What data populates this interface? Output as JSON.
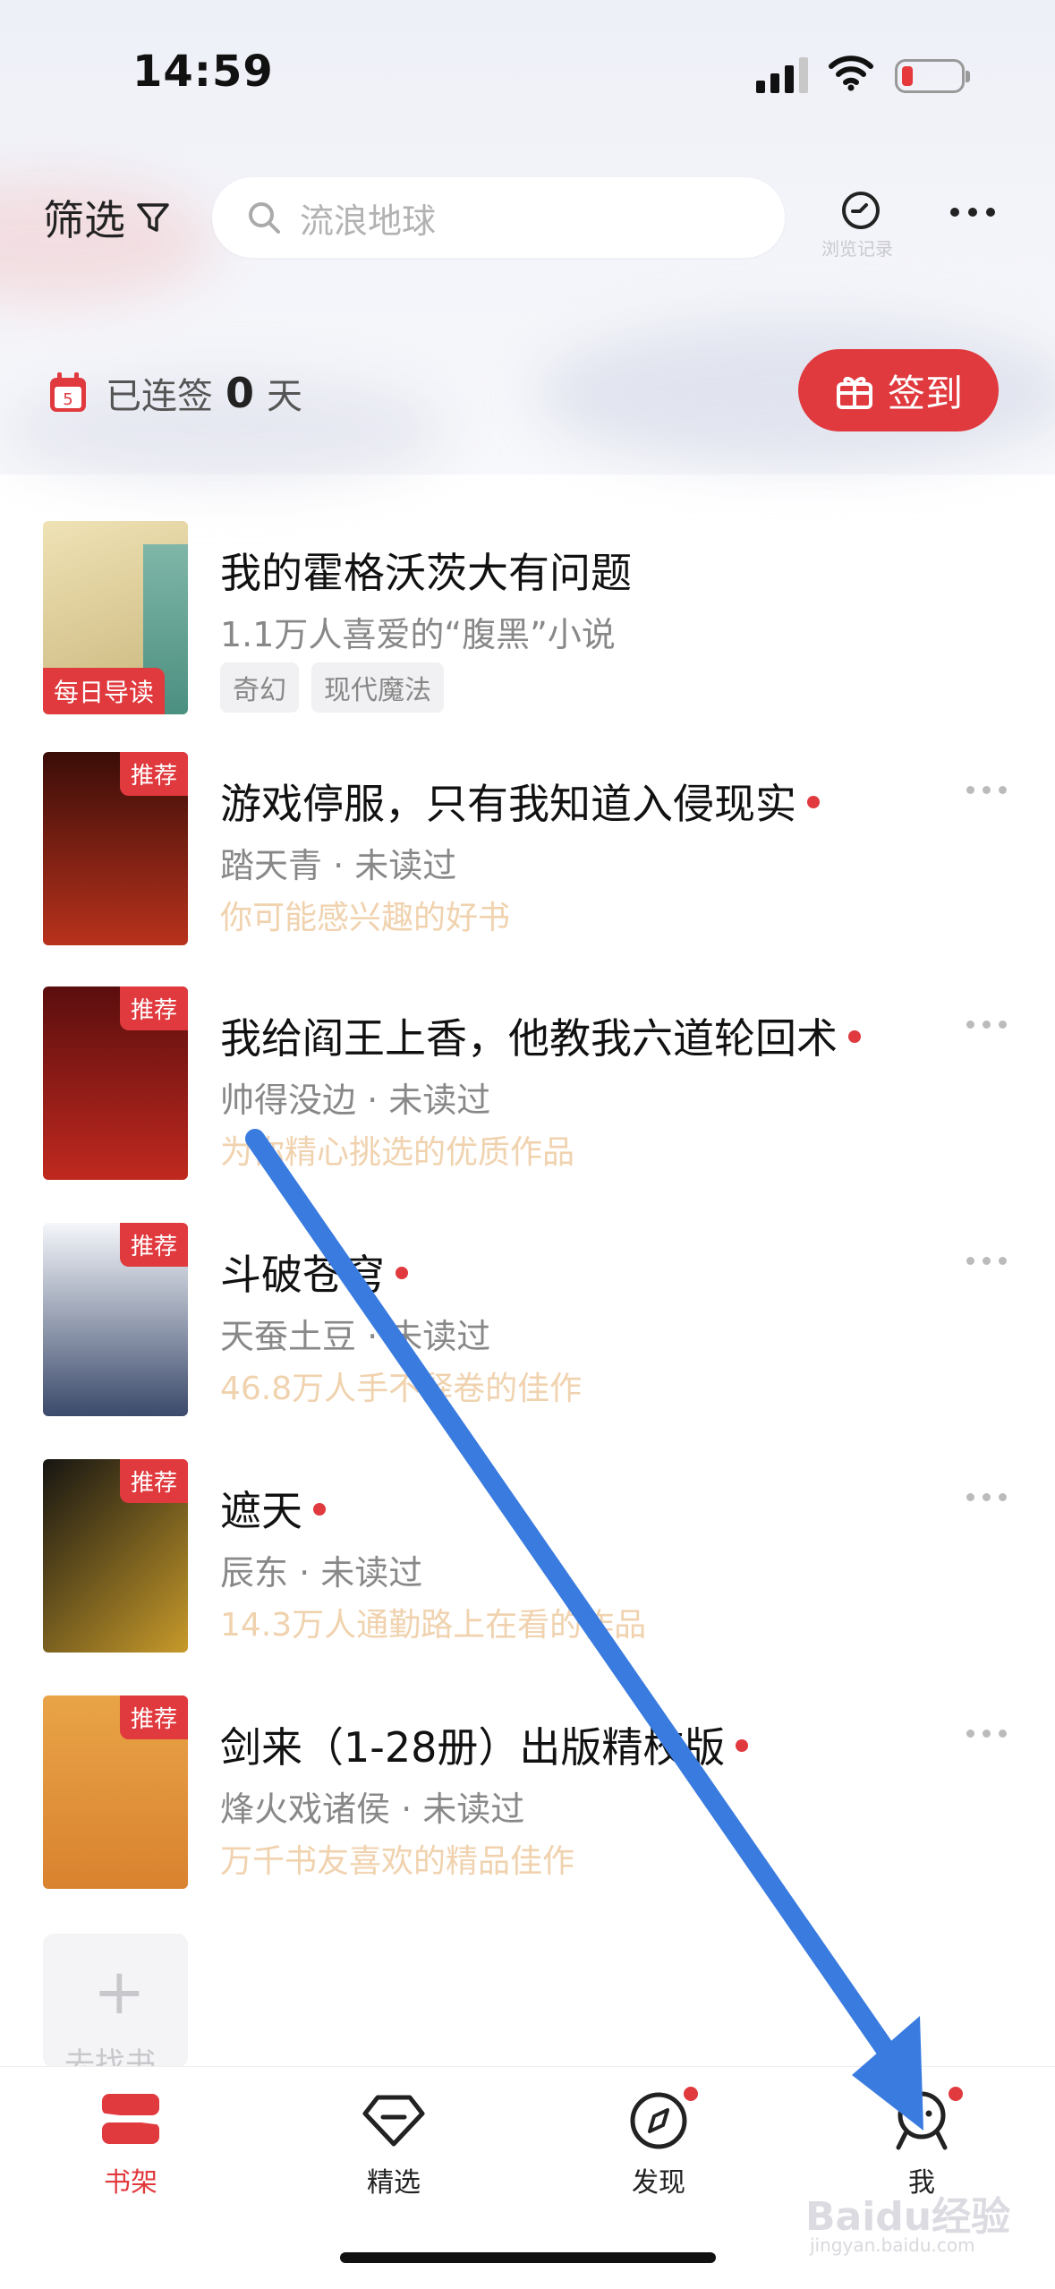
{
  "status": {
    "time": "14:59"
  },
  "header": {
    "filter_label": "筛选",
    "search_placeholder": "流浪地球",
    "history_label": "浏览记录"
  },
  "streak": {
    "calendar_day": "5",
    "prefix": "已连签",
    "days": "0",
    "suffix": "天",
    "signin_label": "签到"
  },
  "books": [
    {
      "title": "我的霍格沃茨大有问题",
      "subtitle": "1.1万人喜爱的“腹黑”小说",
      "badge": "每日导读",
      "chips": [
        "奇幻",
        "现代魔法"
      ],
      "cover_colors": [
        "#efe2b5",
        "#c8b47a"
      ]
    },
    {
      "title": "游戏停服，只有我知道入侵现实",
      "author": "踏天青 · 未读过",
      "rec": "你可能感兴趣的好书",
      "badge": "推荐",
      "cover_colors": [
        "#3a0d08",
        "#b8321c"
      ]
    },
    {
      "title": "我给阎王上香，他教我六道轮回术",
      "author": "帅得没边 · 未读过",
      "rec": "为你精心挑选的优质作品",
      "badge": "推荐",
      "cover_colors": [
        "#5a0e0e",
        "#c0291f"
      ]
    },
    {
      "title": "斗破苍穹",
      "author": "天蚕土豆 · 未读过",
      "rec": "46.8万人手不释卷的佳作",
      "badge": "推荐",
      "cover_colors": [
        "#f4f6fa",
        "#3b4a6b"
      ]
    },
    {
      "title": "遮天",
      "author": "辰东 · 未读过",
      "rec": "14.3万人通勤路上在看的作品",
      "badge": "推荐",
      "cover_colors": [
        "#161512",
        "#c79a2a"
      ]
    },
    {
      "title": "剑来（1-28册）出版精校版",
      "author": "烽火戏诸侯 · 未读过",
      "rec": "万千书友喜欢的精品佳作",
      "badge": "推荐",
      "cover_colors": [
        "#e9a447",
        "#d9822f"
      ]
    }
  ],
  "add_book": {
    "plus": "+",
    "label": "去找书"
  },
  "tabs": [
    {
      "label": "书架",
      "icon": "bookshelf-icon",
      "active": true
    },
    {
      "label": "精选",
      "icon": "diamond-icon"
    },
    {
      "label": "发现",
      "icon": "compass-icon",
      "dot": true
    },
    {
      "label": "我",
      "icon": "profile-icon",
      "dot": true
    }
  ],
  "colors": {
    "accent": "#e0393e",
    "rec_text": "#f0d2ae",
    "arrow": "#3a7be0"
  },
  "watermark": {
    "brand": "Baidu经验",
    "url": "jingyan.baidu.com"
  }
}
